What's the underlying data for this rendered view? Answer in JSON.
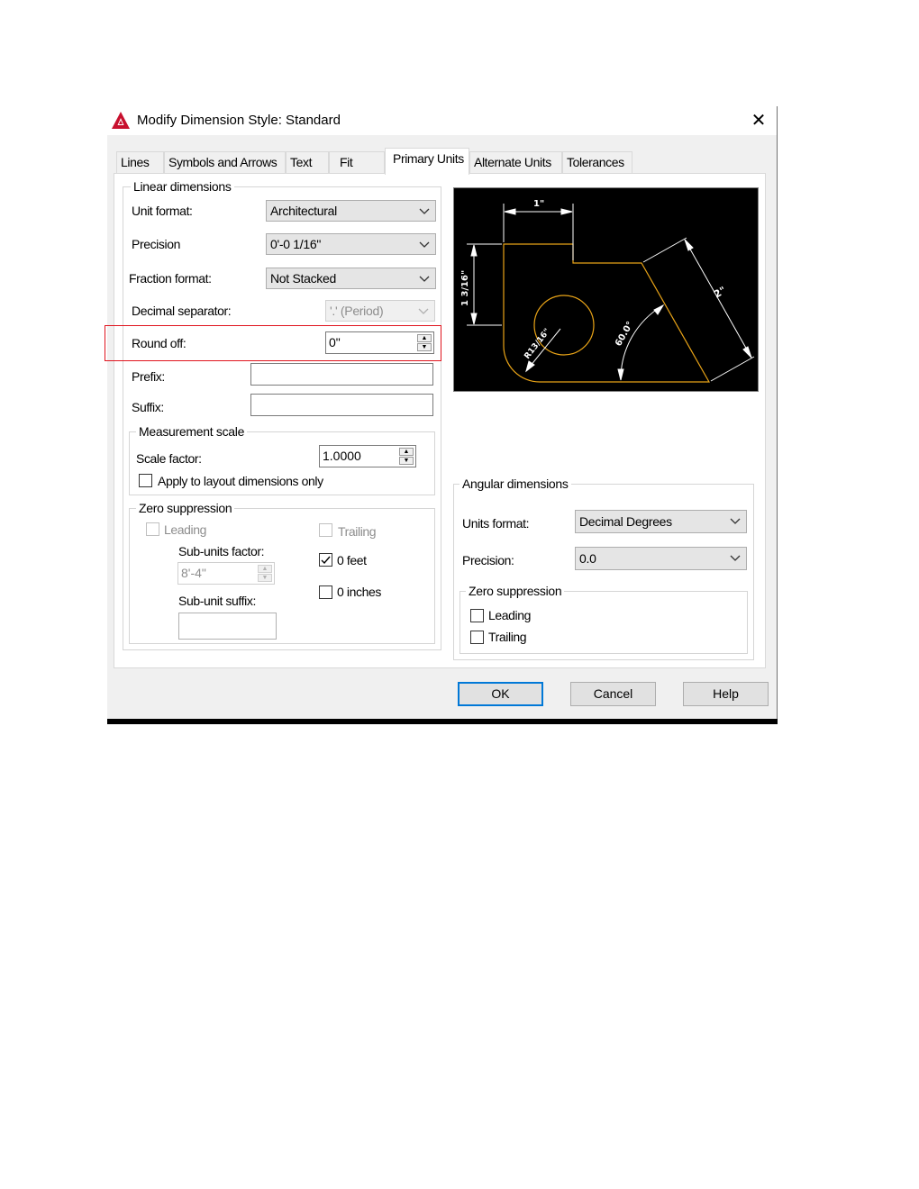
{
  "window": {
    "title": "Modify Dimension Style: Standard",
    "close_glyph": "✕",
    "icon": "autocad-logo-icon"
  },
  "tabs": [
    {
      "label": "Lines",
      "active": false
    },
    {
      "label": "Symbols and Arrows",
      "active": false
    },
    {
      "label": "Text",
      "active": false
    },
    {
      "label": "Fit",
      "active": false
    },
    {
      "label": "Primary Units",
      "active": true
    },
    {
      "label": "Alternate Units",
      "active": false
    },
    {
      "label": "Tolerances",
      "active": false
    }
  ],
  "linear": {
    "legend": "Linear dimensions",
    "unit_format_label": "Unit format:",
    "unit_format_value": "Architectural",
    "precision_label": "Precision",
    "precision_value": "0'-0 1/16\"",
    "fraction_format_label": "Fraction format:",
    "fraction_format_value": "Not Stacked",
    "decimal_sep_label": "Decimal separator:",
    "decimal_sep_value": "'.' (Period)",
    "round_off_label": "Round off:",
    "round_off_value": "0\"",
    "prefix_label": "Prefix:",
    "prefix_value": "",
    "suffix_label": "Suffix:",
    "suffix_value": ""
  },
  "measurement": {
    "legend": "Measurement scale",
    "scale_label": "Scale factor:",
    "scale_value": "1.0000",
    "apply_layout_label": "Apply to layout dimensions only",
    "apply_layout_checked": false
  },
  "zero_linear": {
    "legend": "Zero suppression",
    "leading_label": "Leading",
    "trailing_label": "Trailing",
    "subunits_factor_label": "Sub-units factor:",
    "subunits_factor_value": "8'-4\"",
    "subunit_suffix_label": "Sub-unit suffix:",
    "subunit_suffix_value": "",
    "zero_feet_label": "0 feet",
    "zero_feet_checked": true,
    "zero_inches_label": "0 inches",
    "zero_inches_checked": false
  },
  "preview": {
    "dim_top": "1\"",
    "dim_left": "1 3/16\"",
    "dim_radius": "R13/16\"",
    "dim_angle": "60.0°",
    "dim_diag": "2\"",
    "line_color": "#e8a317",
    "dim_color": "#ffffff"
  },
  "angular": {
    "legend": "Angular dimensions",
    "units_format_label": "Units format:",
    "units_format_value": "Decimal Degrees",
    "precision_label": "Precision:",
    "precision_value": "0.0",
    "zero_legend": "Zero suppression",
    "leading_label": "Leading",
    "trailing_label": "Trailing"
  },
  "buttons": {
    "ok": "OK",
    "cancel": "Cancel",
    "help": "Help"
  },
  "colors": {
    "highlight": "#e0141e",
    "accent": "#0078d7",
    "autocad_red": "#c8102e"
  }
}
